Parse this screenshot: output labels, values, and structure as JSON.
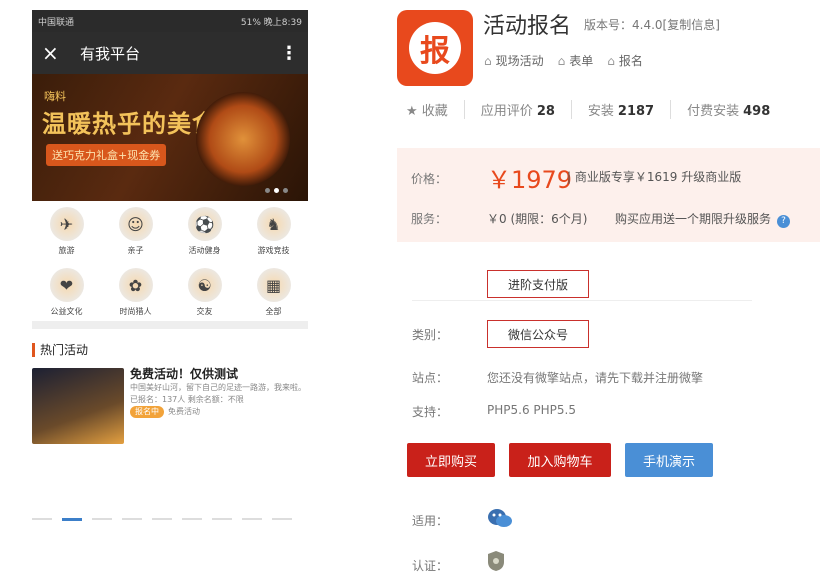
{
  "phone": {
    "status_left": "中国联通",
    "status_right": "51% 晚上8:39",
    "close_icon": "×",
    "title": "有我平台",
    "more_icon": "⋮",
    "banner": {
      "top": "嗨料",
      "headline": "温暖热乎的美食",
      "pill": "送巧克力礼盒+现金券"
    },
    "categories": [
      {
        "label": "旅游",
        "icon": "✈"
      },
      {
        "label": "亲子",
        "icon": "☺"
      },
      {
        "label": "活动健身",
        "icon": "⚽"
      },
      {
        "label": "游戏竞技",
        "icon": "♞"
      },
      {
        "label": "公益文化",
        "icon": "❤"
      },
      {
        "label": "时尚猎人",
        "icon": "✿"
      },
      {
        "label": "交友",
        "icon": "☯"
      },
      {
        "label": "全部",
        "icon": "▦"
      }
    ],
    "hot_title": "热门活动",
    "activity": {
      "title": "免费活动！仅供测试",
      "desc": "中国美好山河，留下自己的足迹一路游，我来啦。",
      "meta": "已报名：137人 剩余名额：不限",
      "tag": "报名中",
      "tag2": "免费活动"
    }
  },
  "app": {
    "logo_char": "报",
    "title": "活动报名",
    "version": "版本号：4.4.0[复制信息]",
    "tags": [
      "现场活动",
      "表单",
      "报名"
    ],
    "collect": "★  收藏",
    "rating_label": "应用评价",
    "rating": "28",
    "install_label": "安装",
    "install": "2187",
    "paid_label": "付费安装",
    "paid": "498"
  },
  "price": {
    "label": "价格：",
    "value": "￥1979",
    "alt": "| 商业版专享￥1619  升级商业版",
    "service_label": "服务：",
    "service_value": "￥0 (期限：6个月)",
    "service_note": "购买应用送一个期限升级服务",
    "help_icon": "?"
  },
  "options": {
    "advanced": "进阶支付版",
    "category_label": "类别：",
    "category_value": "微信公众号"
  },
  "site": {
    "label": "站点：",
    "value": "您还没有微擎站点，请先下载并注册微擎"
  },
  "support": {
    "label": "支持：",
    "value": "PHP5.6   PHP5.5"
  },
  "buttons": {
    "buy": "立即购买",
    "cart": "加入购物车",
    "demo": "手机演示"
  },
  "apply": {
    "label": "适用：",
    "icon": "wechat-icon"
  },
  "cert": {
    "label": "认证：",
    "icon": "shield-icon"
  },
  "colors": {
    "accent": "#e8491d",
    "buy": "#c9211a",
    "demo": "#4a8fd6"
  }
}
